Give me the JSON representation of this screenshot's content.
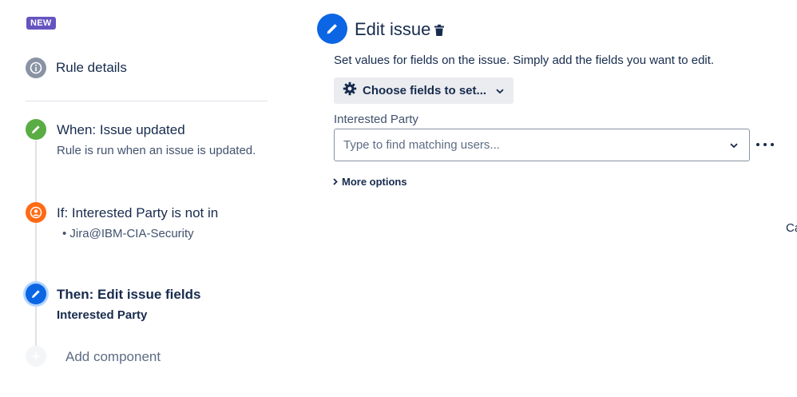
{
  "badge": "NEW",
  "sidebar": {
    "rule_details": "Rule details",
    "steps": [
      {
        "title": "When: Issue updated",
        "desc": "Rule is run when an issue is updated."
      },
      {
        "title": "If: Interested Party is not in",
        "bullet": "• Jira@IBM-CIA-Security"
      },
      {
        "title": "Then: Edit issue fields",
        "desc": "Interested Party"
      }
    ],
    "add_component": "Add component"
  },
  "panel": {
    "title": "Edit issue",
    "description": "Set values for fields on the issue. Simply add the fields you want to edit.",
    "choose_fields_label": "Choose fields to set...",
    "field_label": "Interested Party",
    "user_input": {
      "value": "",
      "placeholder": "Type to find matching users..."
    },
    "more_options": "More options",
    "cut_off_text": "Ca"
  },
  "icons": {
    "rule_details": "info-icon",
    "when": "pencil-icon",
    "if": "user-icon",
    "then": "pencil-icon",
    "add": "plus-icon",
    "edit": "pencil-icon",
    "delete": "trash-icon",
    "choose": "gear-icon",
    "dropdown": "chevron-down-icon",
    "more": "more-icon",
    "expand": "chevron-right-icon"
  },
  "colors": {
    "badge": "#6554c0",
    "when": "#5aac44",
    "if": "#ff6a13",
    "then": "#0c66e4",
    "info": "#8993a4"
  }
}
